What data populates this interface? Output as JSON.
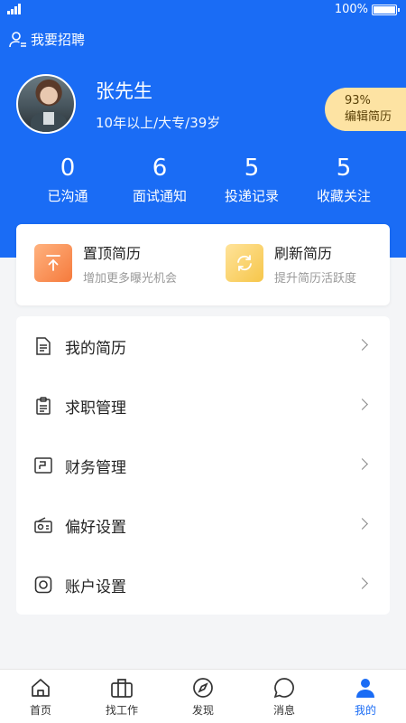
{
  "status_bar": {
    "battery_text": "100%"
  },
  "header": {
    "recruit_label": "我要招聘"
  },
  "profile": {
    "name": "张先生",
    "info": "10年以上/大专/39岁"
  },
  "resume_badge": {
    "percent": "93%",
    "label": "编辑简历"
  },
  "stats": [
    {
      "value": "0",
      "label": "已沟通"
    },
    {
      "value": "6",
      "label": "面试通知"
    },
    {
      "value": "5",
      "label": "投递记录"
    },
    {
      "value": "5",
      "label": "收藏关注"
    }
  ],
  "actions": [
    {
      "title": "置顶简历",
      "subtitle": "增加更多曝光机会",
      "icon": "arrow-up-to-top-icon",
      "color": "#f57a3c"
    },
    {
      "title": "刷新简历",
      "subtitle": "提升简历活跃度",
      "icon": "refresh-icon",
      "color": "#f6c64a"
    }
  ],
  "menu": [
    {
      "label": "我的简历",
      "icon": "document-icon"
    },
    {
      "label": "求职管理",
      "icon": "clipboard-icon"
    },
    {
      "label": "财务管理",
      "icon": "wallet-icon"
    },
    {
      "label": "偏好设置",
      "icon": "radio-icon"
    },
    {
      "label": "账户设置",
      "icon": "camera-icon"
    }
  ],
  "tabbar": [
    {
      "label": "首页",
      "icon": "home-icon"
    },
    {
      "label": "找工作",
      "icon": "briefcase-icon"
    },
    {
      "label": "发现",
      "icon": "compass-icon"
    },
    {
      "label": "消息",
      "icon": "chat-icon"
    },
    {
      "label": "我的",
      "icon": "person-icon",
      "active": true
    }
  ],
  "colors": {
    "primary": "#1a6cf5",
    "badge_bg": "#fde3a3"
  }
}
